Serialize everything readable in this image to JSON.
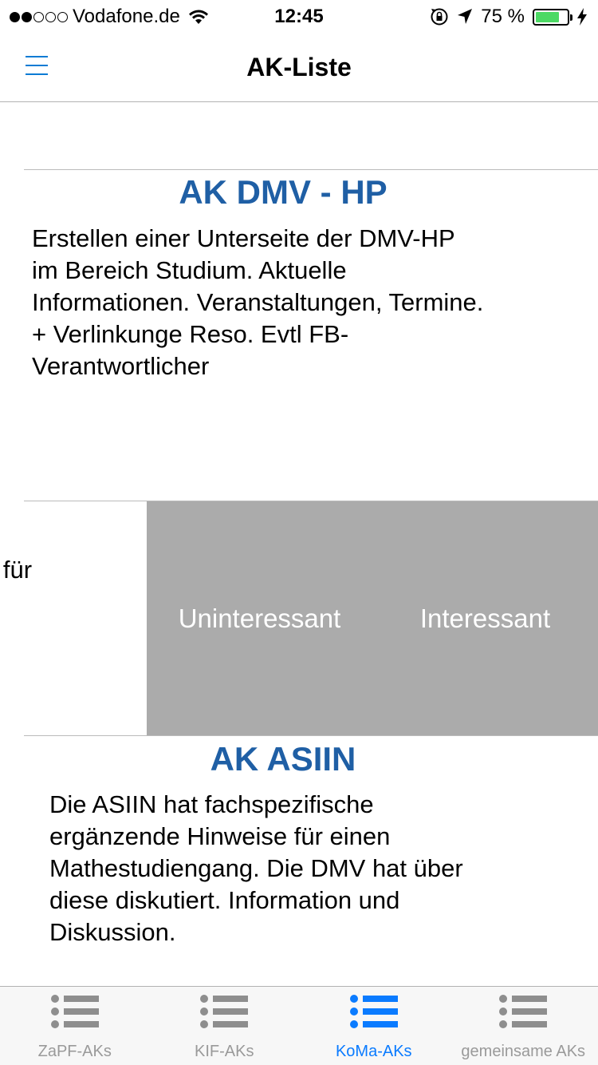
{
  "status_bar": {
    "carrier": "Vodafone.de",
    "time": "12:45",
    "battery_percent": "75 %",
    "battery_level": 0.75,
    "battery_color": "#4cd964",
    "icons": [
      "signal-dots-icon",
      "wifi-icon",
      "rotation-lock-icon",
      "location-arrow-icon",
      "battery-icon",
      "charging-bolt-icon"
    ]
  },
  "nav": {
    "title": "AK-Liste",
    "menu_icon": "hamburger-menu-icon",
    "accent": "#0a7bd4"
  },
  "cards": [
    {
      "title": "AK DMV - HP",
      "description_lines": [
        "Erstellen einer Unterseite der DMV-HP",
        "im Bereich Studium. Aktuelle",
        "Informationen. Veranstaltungen, Termine.",
        "+ Verlinkunge Reso. Evtl FB-",
        "Verantwortlicher"
      ]
    },
    {
      "partial_text": "e für",
      "actions": {
        "uninteresting": "Uninteressant",
        "interesting": "Interessant"
      }
    },
    {
      "title": "AK ASIIN",
      "description_lines": [
        "Die ASIIN hat fachspezifische",
        "ergänzende Hinweise für einen",
        "Mathestudiengang. Die DMV hat über",
        "diese diskutiert. Information und",
        "Diskussion."
      ]
    }
  ],
  "title_color": "#1f5fa5",
  "tabs": [
    {
      "label": "ZaPF-AKs",
      "icon": "list-icon",
      "active": false
    },
    {
      "label": "KIF-AKs",
      "icon": "list-icon",
      "active": false
    },
    {
      "label": "KoMa-AKs",
      "icon": "list-icon",
      "active": true
    },
    {
      "label": "gemeinsame AKs",
      "icon": "list-icon",
      "active": false
    }
  ],
  "active_tab_color": "#0a7bff"
}
